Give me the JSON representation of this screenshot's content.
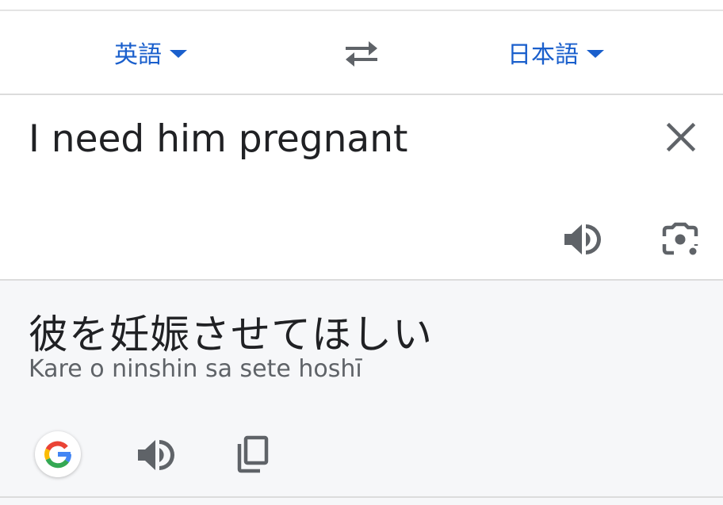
{
  "language_bar": {
    "source_language": "英語",
    "target_language": "日本語"
  },
  "source": {
    "text": "I need him pregnant"
  },
  "result": {
    "translation": "彼を妊娠させてほしい",
    "romanization": "Kare o ninshin sa sete hoshī"
  },
  "icons": {
    "swap": "swap-icon",
    "clear": "close-icon",
    "speaker": "speaker-icon",
    "camera": "camera-icon",
    "google": "google-logo-icon",
    "copy": "copy-icon"
  },
  "colors": {
    "accent": "#1a5fcc",
    "text": "#202124",
    "secondary_text": "#5f6368",
    "icon": "#5f6368",
    "result_background": "#f6f7f9"
  }
}
